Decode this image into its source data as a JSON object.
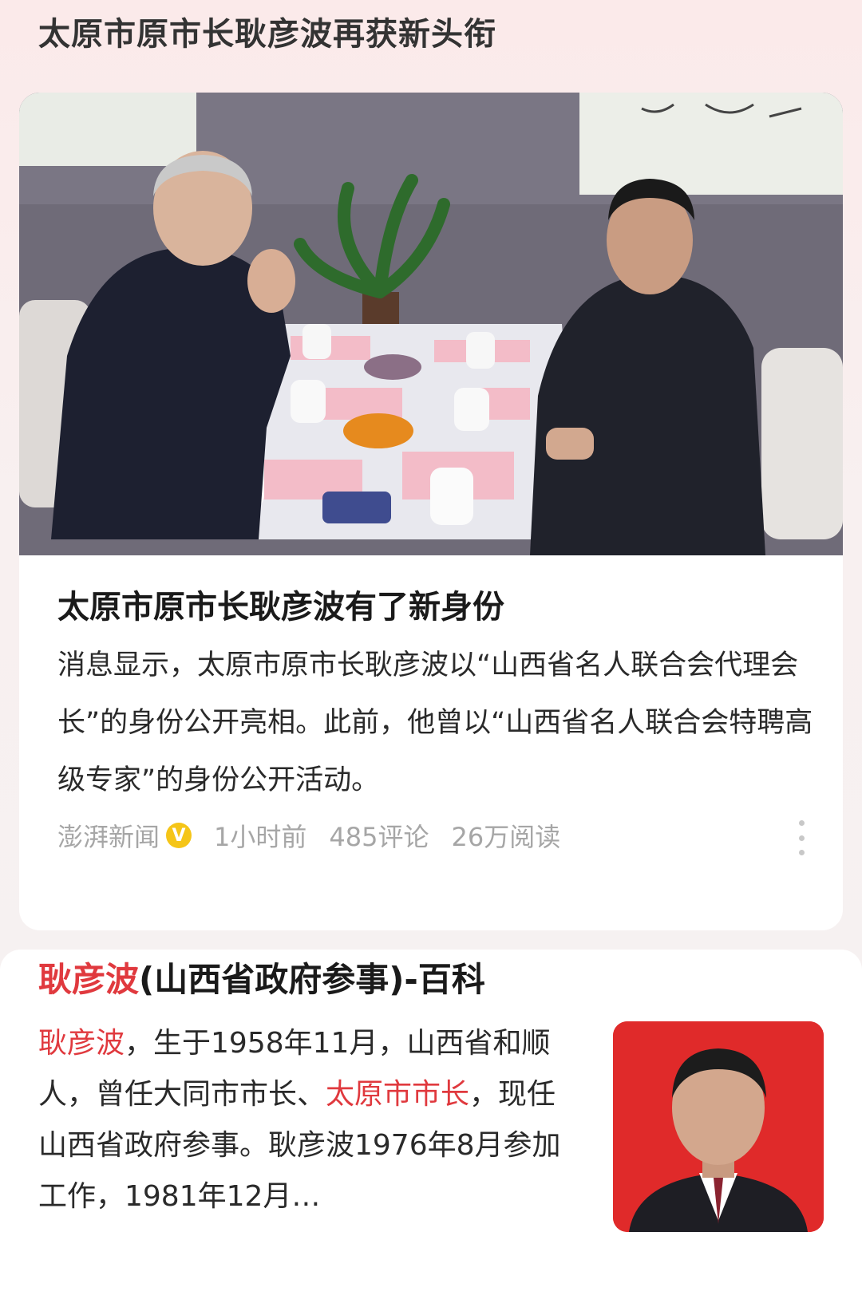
{
  "topic": {
    "title": "太原市原市长耿彦波再获新头衔"
  },
  "news": {
    "headline": "太原市原市长耿彦波有了新身份",
    "summary": "消息显示，太原市原市长耿彦波以“山西省名人联合会代理会长”的身份公开亮相。此前，他曾以“山西省名人联合会特聘高级专家”的身份公开活动。",
    "source": "澎湃新闻",
    "verified_mark": "V",
    "time": "1小时前",
    "comments": "485评论",
    "reads": "26万阅读"
  },
  "baike": {
    "title_highlight": "耿彦波",
    "title_rest": "(山西省政府参事)-百科",
    "segments": [
      {
        "text": "耿彦波",
        "highlight": true
      },
      {
        "text": "，生于1958年11月，山西省和顺人，曾任大同市市长、",
        "highlight": false
      },
      {
        "text": "太原市市长",
        "highlight": true
      },
      {
        "text": "，现任山西省政府参事。耿彦波1976年8月参加工作，1981年12月…",
        "highlight": false
      }
    ]
  },
  "colors": {
    "accent": "#e0393e",
    "verified": "#f5c518",
    "meta": "#a6a6a6"
  }
}
